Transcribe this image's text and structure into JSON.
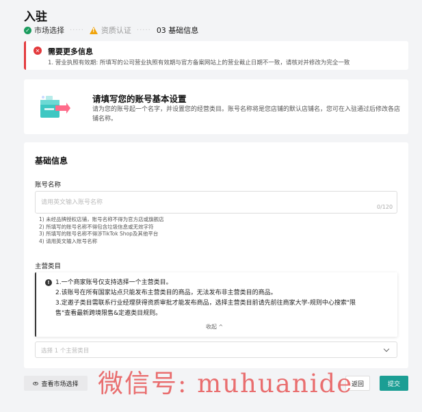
{
  "page": {
    "title": "入驻",
    "steps": [
      {
        "label": "市场选择",
        "state": "done"
      },
      {
        "label": "资质认证",
        "state": "warning"
      },
      {
        "label": "03 基础信息",
        "state": "current"
      }
    ]
  },
  "alert": {
    "title": "需要更多信息",
    "message": "1. 营业执照有效期: 所填写的公司营业执照有效期与官方备案网站上的营业截止日期不一致，请核对并修改为完全一致",
    "color": "#e3393c"
  },
  "setup": {
    "title": "请填写您的账号基本设置",
    "description": "请为您的账号起一个名字，并设置您的经营类目。账号名称将是您店铺的默认店铺名，您可在入驻通过后修改各店铺名称。"
  },
  "form": {
    "section_title": "基础信息",
    "account_name": {
      "label": "账号名称",
      "placeholder": "请用英文输入账号名称",
      "value": "",
      "counter": "0/120",
      "rules": [
        "1) 未经品牌授权店铺，账号名称不得为官方店或旗舰店",
        "2) 所填写的账号名称不得包含垃圾信息或无效字符",
        "3) 所填写的账号名称不得涉TikTok Shop及其他平台",
        "4) 请用英文输入账号名称"
      ]
    },
    "main_category": {
      "label": "主营类目",
      "info_lines": [
        "1.一个商家账号仅支持选择一个主营类目。",
        "2.该账号在所有国家站点只能发布主营类目的商品，无法发布非主营类目的商品。",
        "3.定邀子类目需联系行业经理获得资质审批才能发布商品，选择主营类目前请先前往商家大学-规则中心搜索\"限",
        "售\"查看最新跨境限售&定邀类目规则。"
      ],
      "collapse_label": "收起 ^",
      "select_placeholder": "选择 1 个主营类目"
    }
  },
  "footer": {
    "market_button": "查看市场选择",
    "back_button": "返回",
    "submit_button": "提交",
    "accent": "#1b9e94"
  },
  "watermark": "微信号: muhuanide"
}
